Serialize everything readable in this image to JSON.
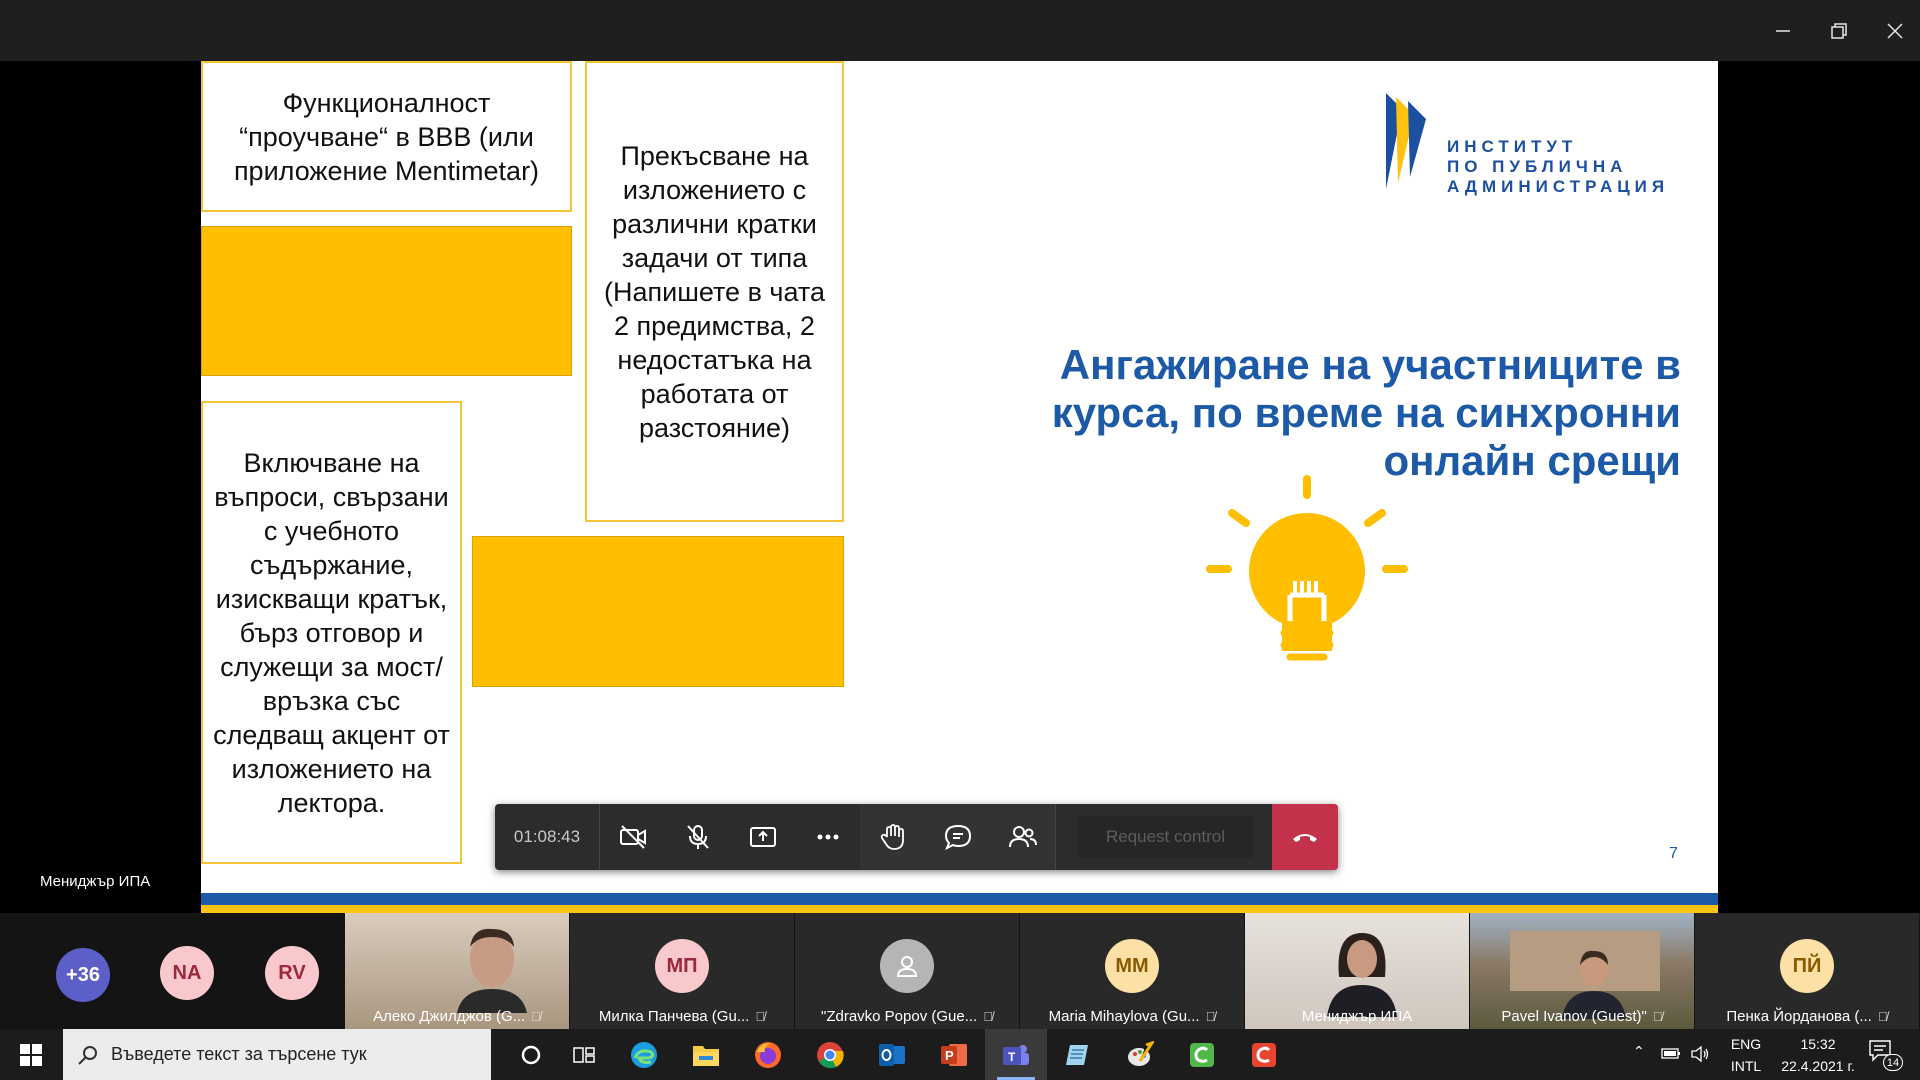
{
  "window": {
    "minimize_icon": "minimize-icon",
    "maximize_icon": "restore-icon",
    "close_icon": "close-icon"
  },
  "slide": {
    "box_top_left": "Функционалност “проучване“ в ВВВ (или приложение Mentimetar)",
    "box_middle": "Прекъсване на изложението с различни кратки задачи от типа (Напишете в чата 2 предимства, 2 недостатъка на работата от разстояние)",
    "box_bottom_left": "Включване на въпроси, свързани с учебното съдържание, изискващи кратък, бърз отговор и служещи за мост/връзка със следващ акцент от изложението на лектора.",
    "logo_line1": "ИНСТИТУТ",
    "logo_line2": "ПО ПУБЛИЧНА",
    "logo_line3": "АДМИНИСТРАЦИЯ",
    "title": "Ангажиране на участниците в курса, по време на синхронни онлайн срещи",
    "page_number": "7",
    "colors": {
      "accent_blue": "#1c5aa8",
      "accent_yellow": "#ffbe00"
    }
  },
  "presenter_label": "Мениджър ИПА",
  "toolbar": {
    "timer": "01:08:43",
    "request_control": "Request control",
    "icons": [
      "camera-off-icon",
      "mic-off-icon",
      "share-screen-icon",
      "more-icon",
      "raise-hand-icon",
      "chat-icon",
      "participants-icon",
      "hangup-icon"
    ]
  },
  "participants": {
    "overflow": "+36",
    "avatars": [
      {
        "initials": "NA",
        "color": "#f8c8cd",
        "text": "#9b2a3a"
      },
      {
        "initials": "RV",
        "color": "#f8c8cd",
        "text": "#9b2a3a"
      }
    ],
    "tiles": [
      {
        "name": "Алеко Джилджов (G...",
        "kind": "video"
      },
      {
        "name": "Милка Панчева (Gu...",
        "kind": "avatar",
        "initials": "МП",
        "color": "#f8c8cd",
        "text": "#9b2a3a"
      },
      {
        "name": "\"Zdravko Popov (Gue...",
        "kind": "avatar",
        "initials": "",
        "color": "#b5b5b5",
        "text": "#fff"
      },
      {
        "name": "Maria Mihaylova (Gu...",
        "kind": "avatar",
        "initials": "ММ",
        "color": "#fde0a6",
        "text": "#8a5a00"
      },
      {
        "name": "Мениджър ИПА",
        "kind": "video"
      },
      {
        "name": "Pavel Ivanov (Guest)\"",
        "kind": "video"
      },
      {
        "name": "Пенка Йорданова (...",
        "kind": "avatar",
        "initials": "ПЙ",
        "color": "#fde0a6",
        "text": "#8a5a00"
      }
    ]
  },
  "taskbar": {
    "search_placeholder": "Въведете текст за търсене тук",
    "apps": [
      "task-view-icon",
      "edge-icon",
      "file-explorer-icon",
      "firefox-icon",
      "chrome-icon",
      "outlook-icon",
      "powerpoint-icon",
      "teams-icon",
      "notepad-icon",
      "paint-icon",
      "camtasia-green-icon",
      "camtasia-red-icon"
    ],
    "lang1": "ENG",
    "lang2": "INTL",
    "time": "15:32",
    "date": "22.4.2021 г.",
    "notification_count": "14"
  }
}
